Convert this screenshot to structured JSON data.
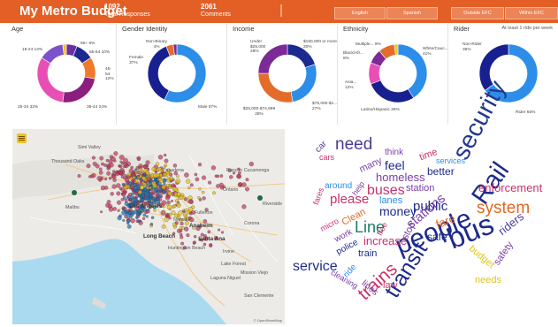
{
  "header": {
    "title": "My Metro Budget",
    "total_responses_value": "1092",
    "total_responses_label": "Total Responses",
    "comments_value": "2061",
    "comments_label": "Comments",
    "buttons": [
      "English",
      "Spanish",
      "Outside EFC",
      "Within EFC"
    ]
  },
  "cards": [
    {
      "title": "Age",
      "segments": [
        {
          "label": "65+ 6%",
          "value": 6,
          "color": "#6b2fa3"
        },
        {
          "label": "55-64 10%",
          "value": 10,
          "color": "#1c2a8f"
        },
        {
          "label": "45-54 12%",
          "value": 12,
          "color": "#f07a2c"
        },
        {
          "label": "35-44 24%",
          "value": 24,
          "color": "#8a1f7e"
        },
        {
          "label": "25-34 32%",
          "value": 32,
          "color": "#e84fb5"
        },
        {
          "label": "18-24 14%",
          "value": 14,
          "color": "#7b52c9"
        },
        {
          "label": "",
          "value": 2,
          "color": "#f4c316"
        }
      ]
    },
    {
      "title": "Gender Identity",
      "segments": [
        {
          "label": "Male 57%",
          "value": 57,
          "color": "#2c8ee9"
        },
        {
          "label": "Female 37%",
          "value": 37,
          "color": "#18208f"
        },
        {
          "label": "Non-Binary 4%",
          "value": 4,
          "color": "#e46c2a"
        },
        {
          "label": "",
          "value": 2,
          "color": "#7b2a96"
        }
      ]
    },
    {
      "title": "Income",
      "segments": [
        {
          "label": "$150,000 or more 20%",
          "value": 20,
          "color": "#1c2a8f"
        },
        {
          "label": "$75,000-$1... 27%",
          "value": 27,
          "color": "#2c8ee9"
        },
        {
          "label": "$25,000-$74,999 28%",
          "value": 28,
          "color": "#e46c2a"
        },
        {
          "label": "Under $25,000 28%",
          "value": 25,
          "color": "#7b2a96"
        }
      ]
    },
    {
      "title": "Ethnicity",
      "segments": [
        {
          "label": "White/Cauc... 41%",
          "value": 41,
          "color": "#2c8ee9"
        },
        {
          "label": "Latino/Hispanic 28%",
          "value": 28,
          "color": "#18208f"
        },
        {
          "label": "Asia... 12%",
          "value": 12,
          "color": "#e84fb5"
        },
        {
          "label": "Black/Afr... 8%",
          "value": 8,
          "color": "#7b2a96"
        },
        {
          "label": "Multiple... 9%",
          "value": 9,
          "color": "#e46c2a"
        },
        {
          "label": "",
          "value": 2,
          "color": "#f4c316"
        }
      ]
    },
    {
      "title": "Rider",
      "subtitle": "At least 1 ride per week",
      "segments": [
        {
          "label": "Rider 65%",
          "value": 65,
          "color": "#2c8ee9"
        },
        {
          "label": "Non-Rider 35%",
          "value": 35,
          "color": "#18208f"
        }
      ]
    }
  ],
  "map": {
    "place_labels": [
      "Simi Valley",
      "Thousand Oaks",
      "Los Angeles",
      "Malibu",
      "Long Beach",
      "Anaheim",
      "Santa Ana",
      "Irvine",
      "Pasadena",
      "Rancho Cucamonga",
      "Riverside",
      "Ontario",
      "Corona",
      "Lake Forest",
      "Laguna Niguel",
      "San Clemente",
      "Mission Viejo",
      "Huntington Beach",
      "Fullerton",
      "Norwalk"
    ],
    "attribution": "© OpenStreetMap"
  },
  "wordcloud": {
    "words": [
      {
        "text": "need",
        "color": "#4b3b99"
      },
      {
        "text": "security",
        "color": "#23378d"
      },
      {
        "text": "bus",
        "color": "#1e2a8c"
      },
      {
        "text": "people",
        "color": "#1e2a8c"
      },
      {
        "text": "transit",
        "color": "#1e2a8c"
      },
      {
        "text": "trains",
        "color": "#c9316b"
      },
      {
        "text": "service",
        "color": "#1e2a8c"
      },
      {
        "text": "Rail",
        "color": "#1e2a8c"
      },
      {
        "text": "system",
        "color": "#e2691f"
      },
      {
        "text": "Line",
        "color": "#1c7f62"
      },
      {
        "text": "buses",
        "color": "#c9316b"
      },
      {
        "text": "please",
        "color": "#c9316b"
      },
      {
        "text": "enforcement",
        "color": "#c9316b"
      },
      {
        "text": "homeless",
        "color": "#7b3fa8"
      },
      {
        "text": "money",
        "color": "#1e2a8c"
      },
      {
        "text": "public",
        "color": "#1e2a8c"
      },
      {
        "text": "stations",
        "color": "#7b3fa8"
      },
      {
        "text": "increase",
        "color": "#c9316b"
      },
      {
        "text": "safe",
        "color": "#1e2a8c"
      },
      {
        "text": "feel",
        "color": "#1e2a8c"
      },
      {
        "text": "cars",
        "color": "#c9316b"
      },
      {
        "text": "car",
        "color": "#4b3b99"
      },
      {
        "text": "many",
        "color": "#7b3fa8"
      },
      {
        "text": "think",
        "color": "#7b3fa8"
      },
      {
        "text": "time",
        "color": "#c9316b"
      },
      {
        "text": "services",
        "color": "#2c8ee9"
      },
      {
        "text": "better",
        "color": "#1e2a8c"
      },
      {
        "text": "station",
        "color": "#7b3fa8"
      },
      {
        "text": "around",
        "color": "#2c8ee9"
      },
      {
        "text": "help",
        "color": "#7b3fa8"
      },
      {
        "text": "fares",
        "color": "#c9316b"
      },
      {
        "text": "lanes",
        "color": "#2c8ee9"
      },
      {
        "text": "fare",
        "color": "#e2691f"
      },
      {
        "text": "riders",
        "color": "#4b3b99"
      },
      {
        "text": "safety",
        "color": "#7b3fa8"
      },
      {
        "text": "budget",
        "color": "#e2c31c"
      },
      {
        "text": "needs",
        "color": "#e2c31c"
      },
      {
        "text": "Clean",
        "color": "#e2691f"
      },
      {
        "text": "micro",
        "color": "#c9316b"
      },
      {
        "text": "work",
        "color": "#7b3fa8"
      },
      {
        "text": "police",
        "color": "#1e2a8c"
      },
      {
        "text": "free",
        "color": "#c9316b"
      },
      {
        "text": "stop",
        "color": "#7b3fa8"
      },
      {
        "text": "train",
        "color": "#1e2a8c"
      },
      {
        "text": "ride",
        "color": "#2c8ee9"
      },
      {
        "text": "law",
        "color": "#c9316b"
      },
      {
        "text": "lines",
        "color": "#7b3fa8"
      },
      {
        "text": "cleaning",
        "color": "#7b3fa8"
      }
    ]
  }
}
